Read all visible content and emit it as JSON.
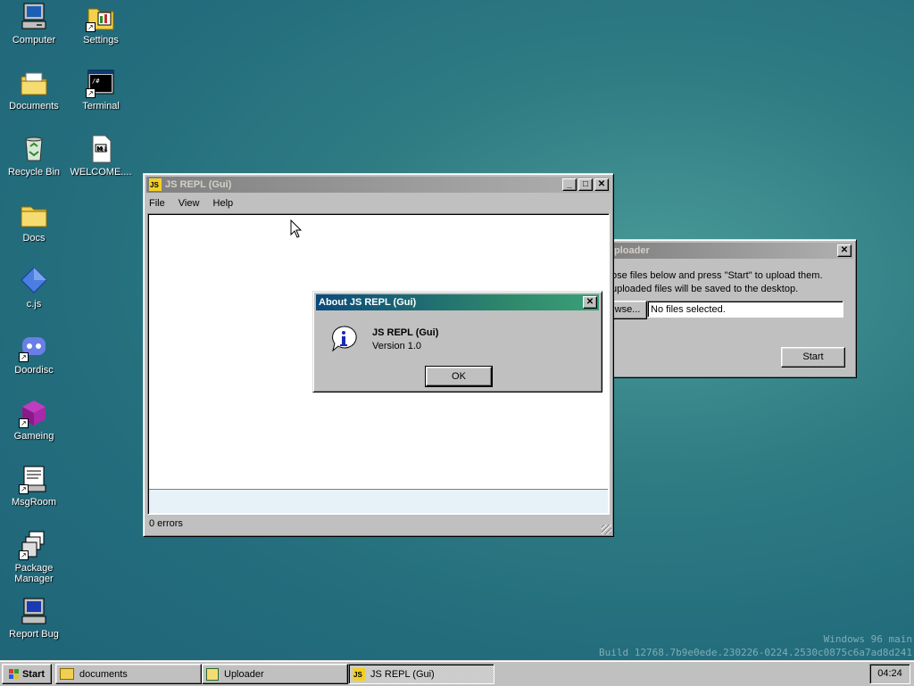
{
  "desktop": {
    "icons": [
      {
        "label": "Computer",
        "icon": "computer-icon"
      },
      {
        "label": "Settings",
        "icon": "settings-icon"
      },
      {
        "label": "Documents",
        "icon": "documents-folder-icon"
      },
      {
        "label": "Terminal",
        "icon": "terminal-icon"
      },
      {
        "label": "Recycle Bin",
        "icon": "recycle-bin-icon"
      },
      {
        "label": "WELCOME....",
        "icon": "welcome-file-icon"
      },
      {
        "label": "Docs",
        "icon": "folder-icon"
      },
      {
        "label": "c.js",
        "icon": "diamond-icon"
      },
      {
        "label": "Doordisc",
        "icon": "discord-icon"
      },
      {
        "label": "Gameing",
        "icon": "cube-icon"
      },
      {
        "label": "MsgRoom",
        "icon": "msgroom-icon"
      },
      {
        "label": "Package Manager",
        "icon": "package-manager-icon"
      },
      {
        "label": "Report Bug",
        "icon": "report-bug-icon"
      }
    ],
    "watermark": {
      "line1": "Windows 96 main",
      "line2": "Build 12768.7b9e0ede.230226-0224.2530c0875c6a7ad8d241"
    }
  },
  "repl_window": {
    "title": "JS REPL (Gui)",
    "menu": [
      "File",
      "View",
      "Help"
    ],
    "status": "0 errors",
    "input_value": ""
  },
  "uploader_window": {
    "title": "Uploader",
    "title_visible": "ploader",
    "line1": "ose files below and press \"Start\" to upload them.",
    "line2": "uploaded files will be saved to the desktop.",
    "browse_label": "wse...",
    "file_status": "No files selected.",
    "start_label": "Start"
  },
  "about_dialog": {
    "title": "About JS REPL (Gui)",
    "app_name": "JS REPL (Gui)",
    "version": "Version 1.0",
    "ok_label": "OK",
    "icon": "info-icon"
  },
  "taskbar": {
    "start_label": "Start",
    "tasks": [
      {
        "label": "documents",
        "icon": "folder-icon"
      },
      {
        "label": "Uploader",
        "icon": "uploader-icon"
      },
      {
        "label": "JS REPL (Gui)",
        "icon": "js-icon"
      }
    ],
    "clock": "04:24"
  },
  "colors": {
    "desktop": "#2f7c83",
    "title_active_start": "#0b4a7a",
    "title_active_end": "#3aa07a",
    "face": "#c0c0c0"
  }
}
